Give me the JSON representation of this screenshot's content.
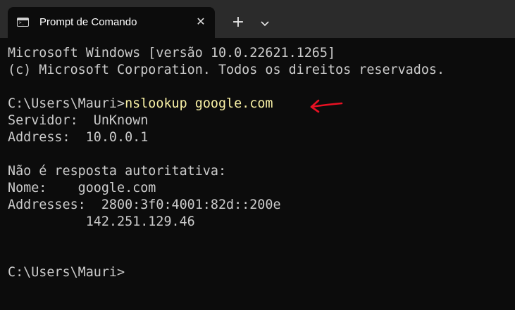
{
  "tab": {
    "title": "Prompt de Comando",
    "icon": "terminal-icon",
    "close_icon": "close-icon"
  },
  "toolbar": {
    "new_tab_glyph": "+",
    "dropdown_icon": "chevron-down-icon"
  },
  "console": {
    "banner_line1": "Microsoft Windows [versão 10.0.22621.1265]",
    "banner_line2": "(c) Microsoft Corporation. Todos os direitos reservados.",
    "prompt1": "C:\\Users\\Mauri>",
    "command1": "nslookup google.com",
    "server_line": "Servidor:  UnKnown",
    "address_line": "Address:  10.0.0.1",
    "non_auth_line": "Não é resposta autoritativa:",
    "name_line": "Nome:    google.com",
    "addresses_line": "Addresses:  2800:3f0:4001:82d::200e",
    "addresses_line2": "          142.251.129.46",
    "prompt2": "C:\\Users\\Mauri>"
  },
  "colors": {
    "background": "#0c0c0c",
    "titlebar": "#2b2b2b",
    "text": "#cccccc",
    "command": "#f9f1a5",
    "annotation_arrow": "#e81123"
  }
}
